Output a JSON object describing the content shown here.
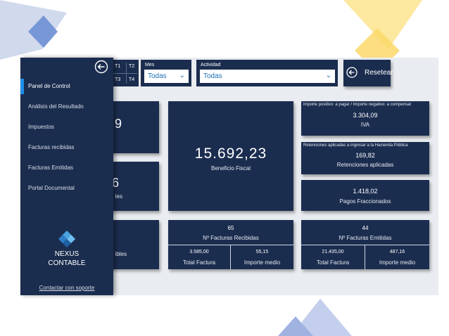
{
  "filters": {
    "quarters": [
      "T1",
      "T2",
      "T3",
      "T4"
    ],
    "month_title": "Mes",
    "month_value": "Todas",
    "activity_title": "Actividad",
    "activity_value": "Todas",
    "reset_label": "Resetear"
  },
  "sidebar": {
    "items": [
      "Panel de Control",
      "Análisis del Resultado",
      "Impuestos",
      "Facturas recibidas",
      "Facturas Emitidas",
      "Portal Documental"
    ],
    "active_item": "Panel de Control",
    "brand_line1": "NEXUS",
    "brand_line2": "CONTABLE",
    "support_link": "Contactar con soporte"
  },
  "cards": {
    "left1": {
      "value": "9"
    },
    "left2": {
      "value": "6",
      "label": "les"
    },
    "left3": {
      "label": "ibles"
    },
    "profit": {
      "value": "15.692,23",
      "label": "Beneficio Fiscal"
    },
    "vat": {
      "note": "importe positivo: a pagar / Importe negativo: a compensar",
      "value": "3.304,09",
      "label": "IVA"
    },
    "withholding": {
      "note": "Retenciones aplicadas a ingresar a la Hacienda Pública",
      "value": "169,82",
      "label": "Retenciones aplicadas"
    },
    "installments": {
      "value": "1.418,02",
      "label": "Pagos Fraccionados"
    },
    "received": {
      "count": "65",
      "title": "Nº Facturas Recibidas",
      "total_value": "3.585,00",
      "total_label": "Total Factura",
      "avg_value": "55,15",
      "avg_label": "Importe medio"
    },
    "issued": {
      "count": "44",
      "title": "Nº Facturas Emitidas",
      "total_value": "21.435,00",
      "total_label": "Total Factura",
      "avg_value": "487,16",
      "avg_label": "Importe medio"
    }
  },
  "colors": {
    "panel_navy": "#1b2d4f",
    "accent_blue": "#1e8ee6",
    "canvas_grey": "#e9ecf0",
    "dropdown_text": "#1c6fb8"
  },
  "icons": [
    "back-arrow-icon",
    "chevron-down-icon",
    "nexus-logo-icon"
  ]
}
